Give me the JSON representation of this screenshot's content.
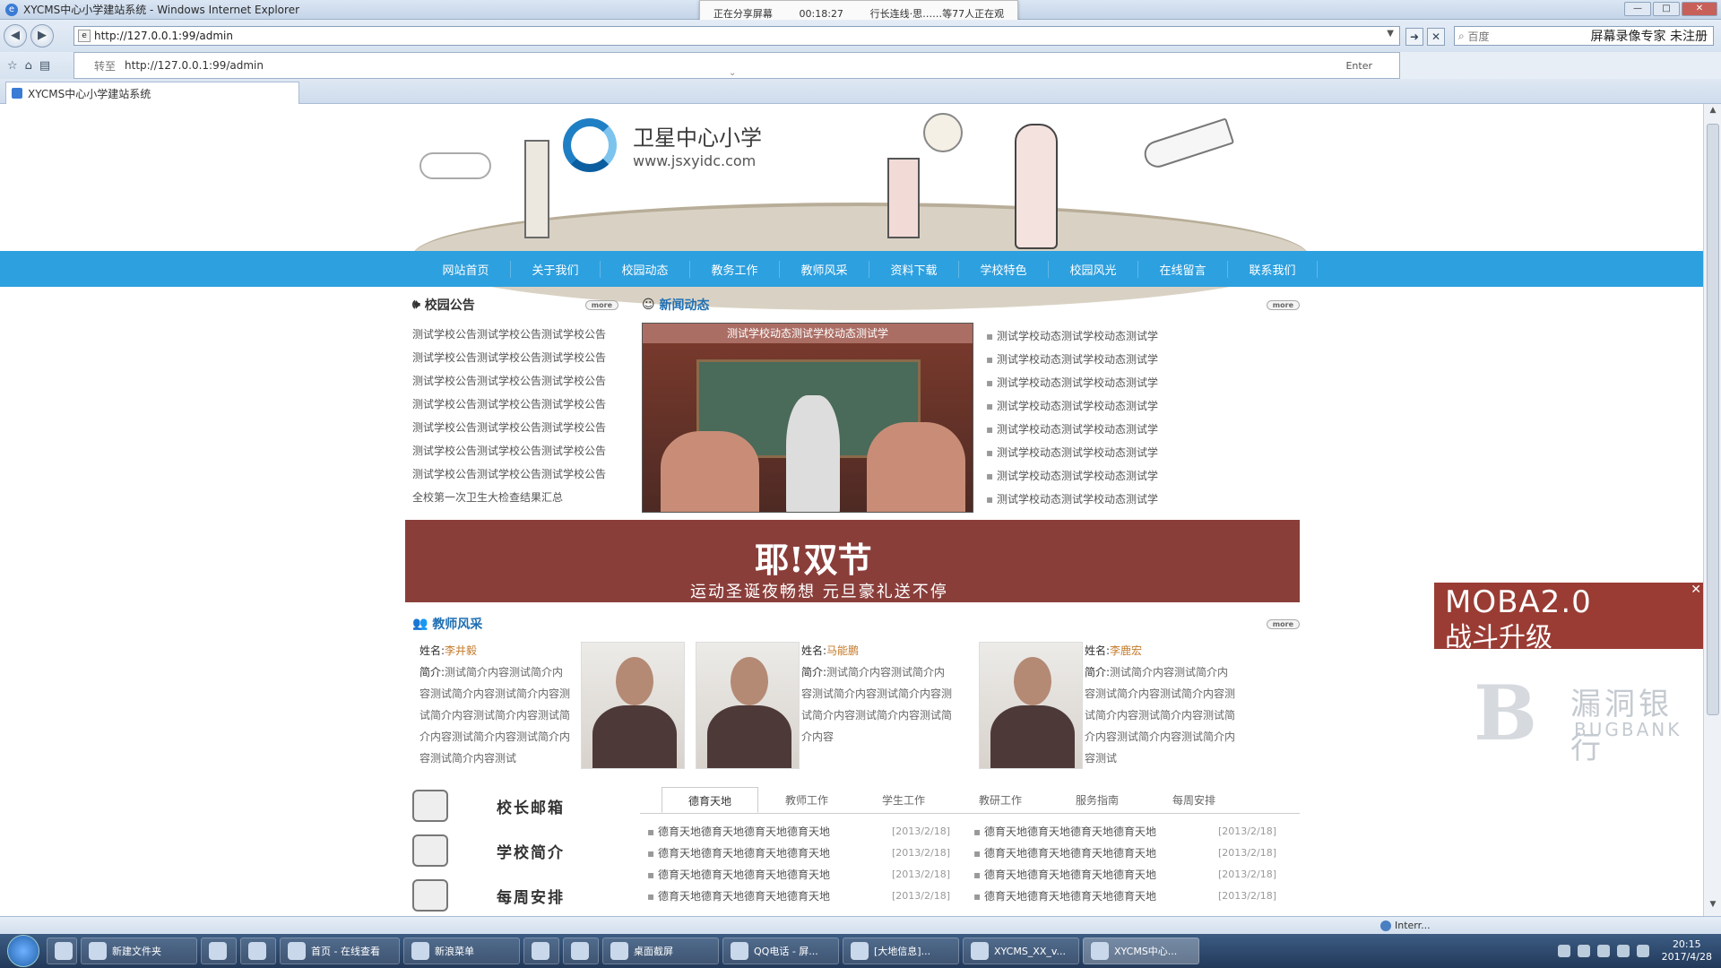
{
  "window": {
    "title": "XYCMS中心小学建站系统 - Windows Internet Explorer",
    "buttons": [
      "—",
      "□",
      "✕"
    ]
  },
  "share_bar": {
    "status": "正在分享屏幕",
    "time": "00:18:27",
    "line": "行长连线·思……等77人正在观"
  },
  "browser": {
    "address": "http://127.0.0.1:99/admin",
    "autocomplete_prefix": "转至",
    "autocomplete_url": "http://127.0.0.1:99/admin",
    "autocomplete_hint": "Enter",
    "search_placeholder": "百度",
    "search_right": "屏幕录像专家 未注册",
    "tab_title": "XYCMS中心小学建站系统"
  },
  "site": {
    "name": "卫星中心小学",
    "url": "www.jsxyidc.com",
    "nav": [
      "网站首页",
      "关于我们",
      "校园动态",
      "教务工作",
      "教师风采",
      "资料下载",
      "学校特色",
      "校园风光",
      "在线留言",
      "联系我们"
    ]
  },
  "notice": {
    "title": "校园公告",
    "more": "more",
    "items": [
      "测试学校公告测试学校公告测试学校公告",
      "测试学校公告测试学校公告测试学校公告",
      "测试学校公告测试学校公告测试学校公告",
      "测试学校公告测试学校公告测试学校公告",
      "测试学校公告测试学校公告测试学校公告",
      "测试学校公告测试学校公告测试学校公告",
      "测试学校公告测试学校公告测试学校公告",
      "全校第一次卫生大检查结果汇总"
    ]
  },
  "news": {
    "title": "新闻动态",
    "more": "more",
    "photo_caption": "测试学校动态测试学校动态测试学",
    "items": [
      "测试学校动态测试学校动态测试学",
      "测试学校动态测试学校动态测试学",
      "测试学校动态测试学校动态测试学",
      "测试学校动态测试学校动态测试学",
      "测试学校动态测试学校动态测试学",
      "测试学校动态测试学校动态测试学",
      "测试学校动态测试学校动态测试学",
      "测试学校动态测试学校动态测试学"
    ]
  },
  "ad_banner": {
    "headline": "耶!双节",
    "subline": "运动圣诞夜畅想 元旦豪礼送不停"
  },
  "teachers": {
    "title": "教师风采",
    "more": "more",
    "name_label": "姓名:",
    "intro_label": "简介:",
    "cards": [
      {
        "name": "李井毅",
        "intro": "测试简介内容测试简介内容测试简介内容测试简介内容测试简介内容测试简介内容测试简介内容测试简介内容测试简介内容测试简介内容测试"
      },
      {
        "name": "马能鹏",
        "intro": "测试简介内容测试简介内容测试简介内容测试简介内容测试简介内容测试简介内容测试简介内容"
      },
      {
        "name": "李鹿宏",
        "intro": "测试简介内容测试简介内容测试简介内容测试简介内容测试简介内容测试简介内容测试简介内容测试简介内容测试简介内容测试"
      }
    ]
  },
  "side_links": [
    "校长邮箱",
    "学校简介",
    "每周安排"
  ],
  "bottom_tabs": [
    "德育天地",
    "教师工作",
    "学生工作",
    "教研工作",
    "服务指南",
    "每周安排"
  ],
  "bottom_list": [
    {
      "left": "德育天地德育天地德育天地德育天地",
      "ldate": "[2013/2/18]",
      "right": "德育天地德育天地德育天地德育天地",
      "rdate": "[2013/2/18]"
    },
    {
      "left": "德育天地德育天地德育天地德育天地",
      "ldate": "[2013/2/18]",
      "right": "德育天地德育天地德育天地德育天地",
      "rdate": "[2013/2/18]"
    },
    {
      "left": "德育天地德育天地德育天地德育天地",
      "ldate": "[2013/2/18]",
      "right": "德育天地德育天地德育天地德育天地",
      "rdate": "[2013/2/18]"
    },
    {
      "left": "德育天地德育天地德育天地德育天地",
      "ldate": "[2013/2/18]",
      "right": "德育天地德育天地德育天地德育天地",
      "rdate": "[2013/2/18]"
    }
  ],
  "float_ad": {
    "line1": "MOBA2.0",
    "line2": "战斗升级",
    "close": "✕"
  },
  "watermark": {
    "mark": "B",
    "cn": "漏洞银行",
    "en": "BUGBANK"
  },
  "status": {
    "zone": "Interr..."
  },
  "taskbar": {
    "items": [
      "新建文件夹",
      "",
      "",
      "首页 - 在线查看",
      "新浪菜单",
      "",
      "",
      "桌面截屏",
      "QQ电话 - 屏...",
      "[大地信息]...",
      "XYCMS_XX_v...",
      "XYCMS中心..."
    ],
    "time": "20:15",
    "date": "2017/4/28"
  },
  "colors": {
    "nav_blue": "#2da0df",
    "ad_red": "#8a3e3a"
  }
}
